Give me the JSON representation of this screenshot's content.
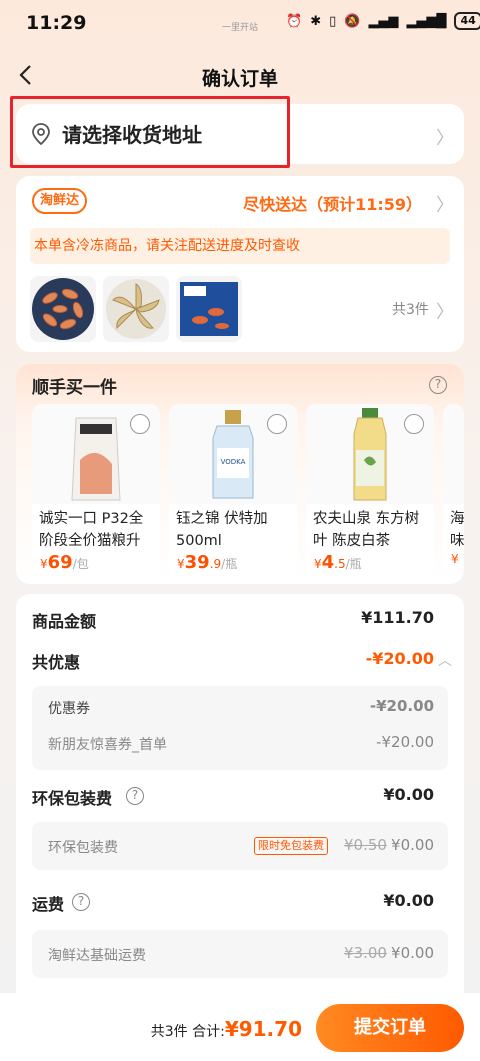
{
  "status_bar": {
    "time": "11:29",
    "carrier_text": "一里开站",
    "battery": "44"
  },
  "header": {
    "title": "确认订单"
  },
  "address": {
    "placeholder": "请选择收货地址"
  },
  "delivery": {
    "brand": "淘鲜达",
    "eta": "尽快送达（预计11:59）",
    "notice": "本单含冷冻商品，请关注配送进度及时查收",
    "count": "共3件"
  },
  "addon": {
    "title": "顺手买一件",
    "products": [
      {
        "name": "诚实一口 P32全阶段全价猫粮升",
        "price_symbol": "¥",
        "price": "69",
        "price_decimal": "",
        "unit": "/包"
      },
      {
        "name": "钰之锦 伏特加 500ml",
        "price_symbol": "¥",
        "price": "39",
        "price_decimal": ".9",
        "unit": "/瓶",
        "label": "VODKA"
      },
      {
        "name": "农夫山泉 东方树叶 陈皮白茶",
        "price_symbol": "¥",
        "price": "4",
        "price_decimal": ".5",
        "unit": "/瓶"
      },
      {
        "name": "海味",
        "price_symbol": "¥",
        "price": "",
        "price_decimal": "",
        "unit": ""
      }
    ]
  },
  "summary": {
    "goods_label": "商品金额",
    "goods_value": "¥111.70",
    "discount_label": "共优惠",
    "discount_value": "-¥20.00",
    "coupon_label": "优惠券",
    "coupon_value": "-¥20.00",
    "coupon_detail_label": "新朋友惊喜券_首单",
    "coupon_detail_value": "-¥20.00",
    "package_label": "环保包装费",
    "package_value": "¥0.00",
    "package_sub_label": "环保包装费",
    "package_tag": "限时免包装费",
    "package_orig": "¥0.50",
    "package_sub_value": "¥0.00",
    "shipping_label": "运费",
    "shipping_value": "¥0.00",
    "shipping_sub_label": "淘鲜达基础运费",
    "shipping_orig": "¥3.00",
    "shipping_sub_value": "¥0.00"
  },
  "footer": {
    "count_text": "共3件 合计:",
    "total": "¥91.70",
    "submit_label": "提交订单"
  },
  "colors": {
    "accent": "#ff5a00",
    "highlight": "#e5242e"
  }
}
